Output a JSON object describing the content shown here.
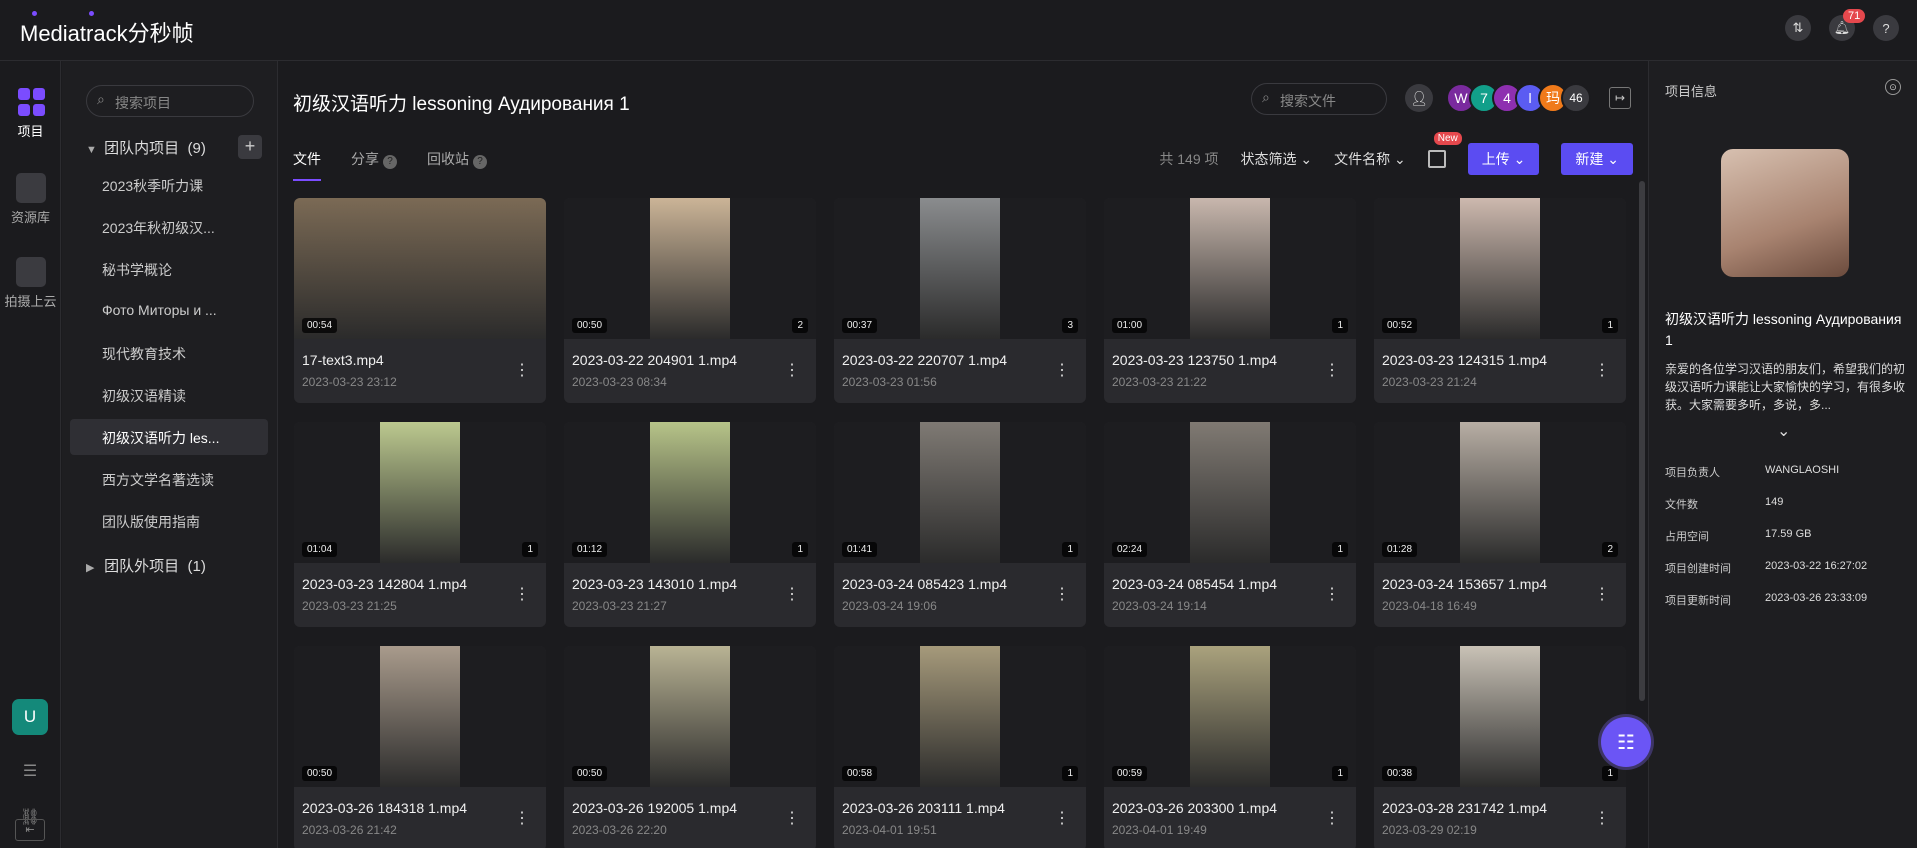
{
  "app": {
    "logo": "Mediatrack分秒帧",
    "notifications": "71"
  },
  "rail": {
    "items": [
      "项目",
      "资源库",
      "拍摄上云"
    ],
    "avatar": "U"
  },
  "sidebar": {
    "search_placeholder": "搜索项目",
    "team_group": "团队内项目",
    "team_count": "(9)",
    "projects": [
      "2023秋季听力课",
      "2023年秋初级汉...",
      "秘书学概论",
      "Фото Миторы и ...",
      "现代教育技术",
      "初级汉语精读",
      "初级汉语听力 les...",
      "西方文学名著选读",
      "团队版使用指南"
    ],
    "outside_group": "团队外项目",
    "outside_count": "(1)"
  },
  "project": {
    "title": "初级汉语听力 lessoning Аудирования 1",
    "file_search_placeholder": "搜索文件",
    "members": [
      {
        "label": "W",
        "color": "#7a2a9e"
      },
      {
        "label": "7",
        "color": "#129f8a"
      },
      {
        "label": "4",
        "color": "#8e2fb0"
      },
      {
        "label": "l",
        "color": "#5b5cf2"
      },
      {
        "label": "玛",
        "color": "#f07a1a"
      },
      {
        "label": "46",
        "color": "#3a3a3f"
      }
    ],
    "tabs": [
      "文件",
      "分享",
      "回收站"
    ],
    "total": "共 149 项",
    "filter": "状态筛选",
    "sort": "文件名称",
    "new_tag": "New",
    "upload": "上传",
    "create": "新建"
  },
  "files": [
    {
      "name": "17-text3.mp4",
      "date": "2023-03-23 23:12",
      "duration": "00:54",
      "comments": "",
      "tone": "#7b6a55"
    },
    {
      "name": "2023-03-22 204901 1.mp4",
      "date": "2023-03-23 08:34",
      "duration": "00:50",
      "comments": "2",
      "tone": "#cbb497"
    },
    {
      "name": "2023-03-22 220707 1.mp4",
      "date": "2023-03-23 01:56",
      "duration": "00:37",
      "comments": "3",
      "tone": "#8a8c8e"
    },
    {
      "name": "2023-03-23 123750 1.mp4",
      "date": "2023-03-23 21:22",
      "duration": "01:00",
      "comments": "1",
      "tone": "#c8b7ad"
    },
    {
      "name": "2023-03-23 124315 1.mp4",
      "date": "2023-03-23 21:24",
      "duration": "00:52",
      "comments": "1",
      "tone": "#cdb9ae"
    },
    {
      "name": "2023-03-23 142804 1.mp4",
      "date": "2023-03-23 21:25",
      "duration": "01:04",
      "comments": "1",
      "tone": "#bcc98f"
    },
    {
      "name": "2023-03-23 143010 1.mp4",
      "date": "2023-03-23 21:27",
      "duration": "01:12",
      "comments": "1",
      "tone": "#b7c489"
    },
    {
      "name": "2023-03-24 085423 1.mp4",
      "date": "2023-03-24 19:06",
      "duration": "01:41",
      "comments": "1",
      "tone": "#7f7a74"
    },
    {
      "name": "2023-03-24 085454 1.mp4",
      "date": "2023-03-24 19:14",
      "duration": "02:24",
      "comments": "1",
      "tone": "#807a73"
    },
    {
      "name": "2023-03-24 153657 1.mp4",
      "date": "2023-04-18 16:49",
      "duration": "01:28",
      "comments": "2",
      "tone": "#b8aea4"
    },
    {
      "name": "2023-03-26 184318 1.mp4",
      "date": "2023-03-26 21:42",
      "duration": "00:50",
      "comments": "",
      "tone": "#a99b8c"
    },
    {
      "name": "2023-03-26 192005 1.mp4",
      "date": "2023-03-26 22:20",
      "duration": "00:50",
      "comments": "",
      "tone": "#b9b394"
    },
    {
      "name": "2023-03-26 203111 1.mp4",
      "date": "2023-04-01 19:51",
      "duration": "00:58",
      "comments": "1",
      "tone": "#a69a7b"
    },
    {
      "name": "2023-03-26 203300 1.mp4",
      "date": "2023-04-01 19:49",
      "duration": "00:59",
      "comments": "1",
      "tone": "#aaa27d"
    },
    {
      "name": "2023-03-28 231742 1.mp4",
      "date": "2023-03-29 02:19",
      "duration": "00:38",
      "comments": "1",
      "tone": "#c9c2b6"
    }
  ],
  "info": {
    "heading": "项目信息",
    "title": "初级汉语听力 lessoning Аудирования 1",
    "description": "亲爱的各位学习汉语的朋友们，希望我们的初级汉语听力课能让大家愉快的学习，有很多收获。大家需要多听，多说，多...",
    "rows": [
      {
        "label": "项目负责人",
        "value": "WANGLAOSHI"
      },
      {
        "label": "文件数",
        "value": "149"
      },
      {
        "label": "占用空间",
        "value": "17.59 GB"
      },
      {
        "label": "项目创建时间",
        "value": "2023-03-22 16:27:02"
      },
      {
        "label": "项目更新时间",
        "value": "2023-03-26 23:33:09"
      }
    ]
  }
}
